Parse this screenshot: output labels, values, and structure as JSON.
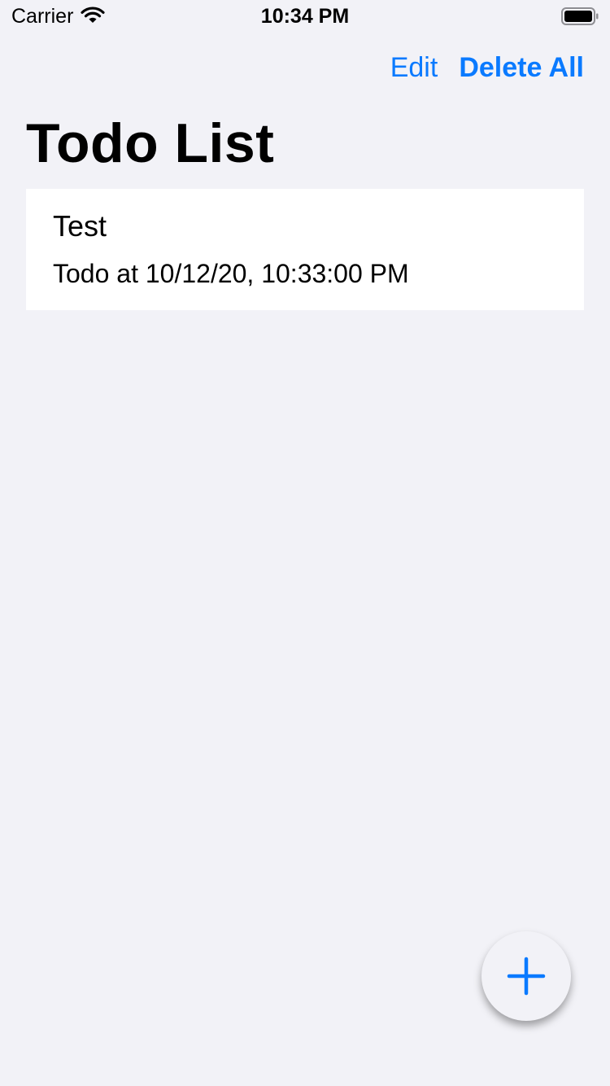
{
  "status_bar": {
    "carrier": "Carrier",
    "time": "10:34 PM",
    "wifi_icon": "wifi-icon",
    "battery_icon": "battery-full-icon"
  },
  "nav": {
    "edit_label": "Edit",
    "delete_all_label": "Delete All",
    "title": "Todo List"
  },
  "todos": [
    {
      "title": "Test",
      "subtitle": "Todo at 10/12/20, 10:33:00 PM"
    }
  ],
  "fab": {
    "icon": "plus-icon"
  },
  "colors": {
    "accent": "#0a7aff",
    "background": "#f2f2f7",
    "card": "#ffffff"
  }
}
